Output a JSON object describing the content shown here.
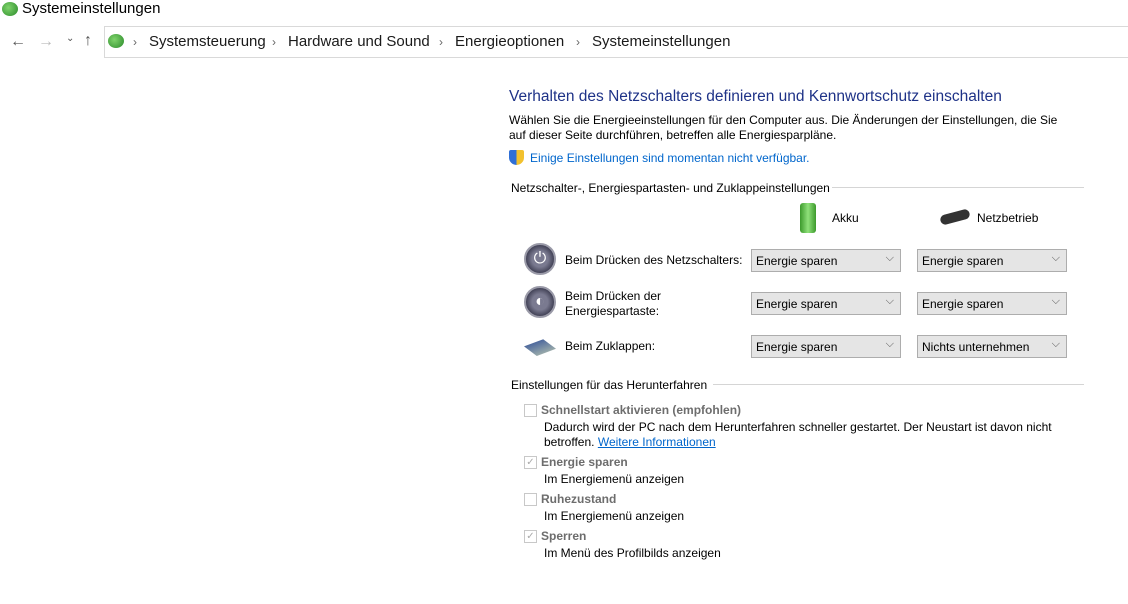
{
  "window": {
    "title": "Systemeinstellungen"
  },
  "breadcrumb": [
    "Systemsteuerung",
    "Hardware und Sound",
    "Energieoptionen",
    "Systemeinstellungen"
  ],
  "page": {
    "heading": "Verhalten des Netzschalters definieren und Kennwortschutz einschalten",
    "description": "Wählen Sie die Energieeinstellungen für den Computer aus. Die Änderungen der Einstellungen, die Sie auf dieser Seite durchführen, betreffen alle Energiesparpläne.",
    "unavailable_link": "Einige Einstellungen sind momentan nicht verfügbar."
  },
  "buttons_group": {
    "title": "Netzschalter-, Energiespartasten- und Zuklappeinstellungen",
    "col_battery": "Akku",
    "col_ac": "Netzbetrieb",
    "rows": [
      {
        "label": "Beim Drücken des Netzschalters:",
        "battery": "Energie sparen",
        "ac": "Energie sparen"
      },
      {
        "label": "Beim Drücken der Energiespartaste:",
        "battery": "Energie sparen",
        "ac": "Energie sparen"
      },
      {
        "label": "Beim Zuklappen:",
        "battery": "Energie sparen",
        "ac": "Nichts unternehmen"
      }
    ]
  },
  "shutdown_group": {
    "title": "Einstellungen für das Herunterfahren",
    "items": [
      {
        "label": "Schnellstart aktivieren (empfohlen)",
        "checked": false,
        "desc": "Dadurch wird der PC nach dem Herunterfahren schneller gestartet. Der Neustart ist davon nicht betroffen.",
        "link": "Weitere Informationen"
      },
      {
        "label": "Energie sparen",
        "checked": true,
        "desc": "Im Energiemenü anzeigen"
      },
      {
        "label": "Ruhezustand",
        "checked": false,
        "desc": "Im Energiemenü anzeigen"
      },
      {
        "label": "Sperren",
        "checked": true,
        "desc": "Im Menü des Profilbilds anzeigen"
      }
    ]
  }
}
